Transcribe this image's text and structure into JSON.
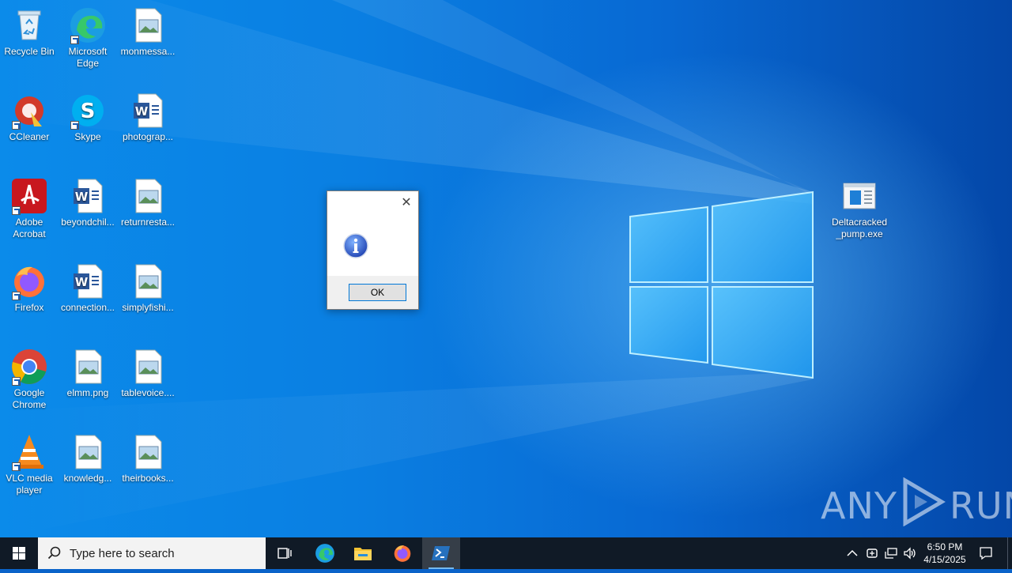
{
  "desktop": {
    "icons": [
      {
        "label": "Recycle Bin",
        "icon": "recycle-bin-icon"
      },
      {
        "label": "Microsoft Edge",
        "icon": "edge-icon"
      },
      {
        "label": "monmessa...",
        "icon": "image-file-icon"
      },
      {
        "label": "CCleaner",
        "icon": "ccleaner-icon"
      },
      {
        "label": "Skype",
        "icon": "skype-icon"
      },
      {
        "label": "photograp...",
        "icon": "word-doc-icon"
      },
      {
        "label": "Adobe Acrobat",
        "icon": "acrobat-icon"
      },
      {
        "label": "beyondchil...",
        "icon": "word-doc-icon"
      },
      {
        "label": "returnresta...",
        "icon": "image-file-icon"
      },
      {
        "label": "Firefox",
        "icon": "firefox-icon"
      },
      {
        "label": "connection...",
        "icon": "word-doc-icon"
      },
      {
        "label": "simplyfishi...",
        "icon": "image-file-icon"
      },
      {
        "label": "Google Chrome",
        "icon": "chrome-icon"
      },
      {
        "label": "elmm.png",
        "icon": "image-file-icon"
      },
      {
        "label": "tablevoice....",
        "icon": "image-file-icon"
      },
      {
        "label": "VLC media player",
        "icon": "vlc-icon"
      },
      {
        "label": "knowledg...",
        "icon": "image-file-icon"
      },
      {
        "label": "theirbooks...",
        "icon": "image-file-icon"
      },
      {
        "label": "Deltacracked _pump.exe",
        "icon": "exe-file-icon"
      }
    ]
  },
  "dialog": {
    "close_glyph": "✕",
    "ok_label": "OK",
    "icon": "information-icon"
  },
  "watermark": {
    "left": "ANY",
    "right": "RUN"
  },
  "taskbar": {
    "search_placeholder": "Type here to search",
    "pinned": [
      "task-view-icon",
      "edge-icon",
      "file-explorer-icon",
      "firefox-icon",
      "powershell-icon"
    ],
    "clock_time": "6:50 PM",
    "clock_date": "4/15/2025"
  },
  "colors": {
    "taskbar_bg": "#101a26",
    "accent": "#0078d7",
    "desktop_blue": "#0a7fe2"
  }
}
